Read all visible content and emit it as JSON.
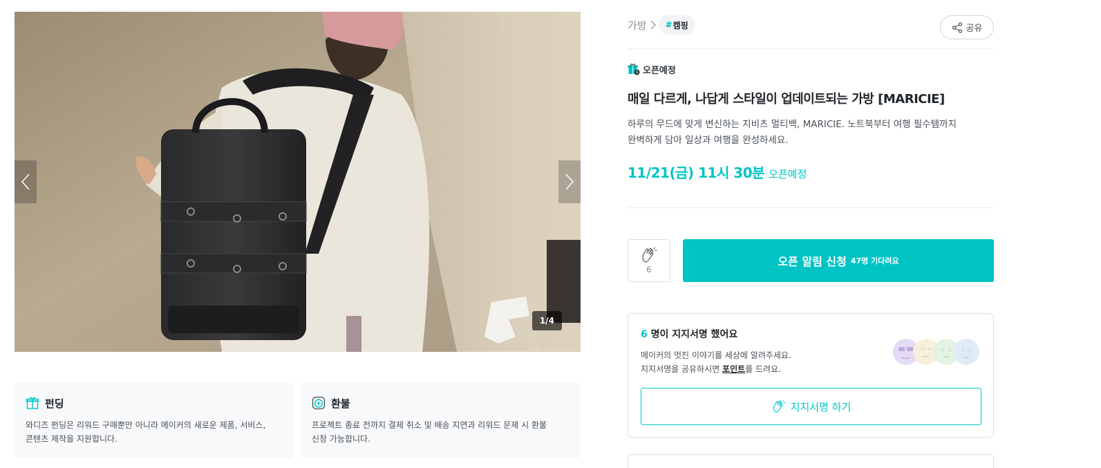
{
  "carousel": {
    "counter": "1/4",
    "prev_icon": "chevron-left-icon",
    "next_icon": "chevron-right-icon"
  },
  "info_cards": [
    {
      "icon": "gift-icon",
      "title": "펀딩",
      "desc_line1": "와디즈 펀딩은 리워드 구매뿐만 아니라 메이커의 새로운 제품, 서비스,",
      "desc_line2": "콘텐츠 제작을 지원합니다."
    },
    {
      "icon": "refund-icon",
      "title": "환불",
      "desc_line1": "프로젝트 종료 전까지 결제 취소 및 배송 지연과 리워드 문제 시 환불",
      "desc_line2": "신청 가능합니다."
    }
  ],
  "breadcrumb": {
    "category": "가방",
    "tag_hash": "#",
    "tag": "캠핑"
  },
  "share": {
    "label": "공유"
  },
  "status": {
    "label": "오픈예정",
    "icon": "gift-clock-icon"
  },
  "title": "매일 다르게, 나답게 스타일이 업데이트되는 가방 [MARICIE]",
  "description": {
    "line1": "하루의 무드에 맞게 변신하는 지비츠 멀티백, MARICIE. 노트북부터 여행 필수템까지",
    "line2": "완벽하게 담아 일상과 여행을 완성하세요."
  },
  "open": {
    "date": "11/21(금) 11시 30분",
    "note": "오픈예정"
  },
  "clap": {
    "count": "6",
    "icon": "clapping-hands-icon"
  },
  "cta": {
    "main": "오픈 알림 신청",
    "sub": "47명 기다려요"
  },
  "support": {
    "count": "6",
    "head_rest": " 명이 지지서명 했어요",
    "line1": "메이커의 멋진 이야기를 세상에 알려주세요.",
    "line2_pre": "지지서명을 공유하시면 ",
    "line2_point": "포인트",
    "line2_post": "를 드려요.",
    "button": "지지서명 하기",
    "face_colors": [
      "#e4dcf4",
      "#f5efd9",
      "#e3f2e1",
      "#dfeaf5"
    ]
  },
  "colors": {
    "accent": "#00c4c4",
    "text": "#212529",
    "muted": "#868e96"
  }
}
